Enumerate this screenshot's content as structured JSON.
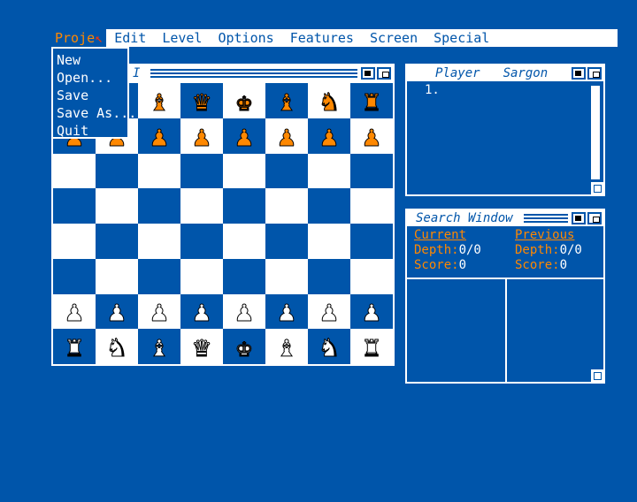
{
  "menubar": {
    "items": [
      "Proje",
      "Edit",
      "Level",
      "Options",
      "Features",
      "Screen",
      "Special"
    ]
  },
  "project_menu": {
    "items": [
      "New",
      "Open...",
      "Save",
      "Save As...",
      "Quit"
    ]
  },
  "board_window": {
    "title": "I"
  },
  "board": [
    [
      "♜",
      "♞",
      "♝",
      "♛",
      "♚",
      "♝",
      "♞",
      "♜"
    ],
    [
      "♟",
      "♟",
      "♟",
      "♟",
      "♟",
      "♟",
      "♟",
      "♟"
    ],
    [
      "",
      "",
      "",
      "",
      "",
      "",
      "",
      ""
    ],
    [
      "",
      "",
      "",
      "",
      "",
      "",
      "",
      ""
    ],
    [
      "",
      "",
      "",
      "",
      "",
      "",
      "",
      ""
    ],
    [
      "",
      "",
      "",
      "",
      "",
      "",
      "",
      ""
    ],
    [
      "♟",
      "♟",
      "♟",
      "♟",
      "♟",
      "♟",
      "♟",
      "♟"
    ],
    [
      "♜",
      "♞",
      "♝",
      "♛",
      "♚",
      "♝",
      "♞",
      "♜"
    ]
  ],
  "moves_window": {
    "col_player": "Player",
    "col_sargon": "Sargon",
    "first_move": "1."
  },
  "search_window": {
    "title": "Search Window",
    "current_label": "Current",
    "previous_label": "Previous",
    "current_depth_label": "Depth:",
    "current_depth_value": "0/0",
    "current_score_label": "Score:",
    "current_score_value": "0",
    "previous_depth_label": "Depth:",
    "previous_depth_value": "0/0",
    "previous_score_label": "Score:",
    "previous_score_value": "0"
  },
  "colors": {
    "background": "#0055aa",
    "white": "#ffffff",
    "accent": "#ff8800"
  }
}
